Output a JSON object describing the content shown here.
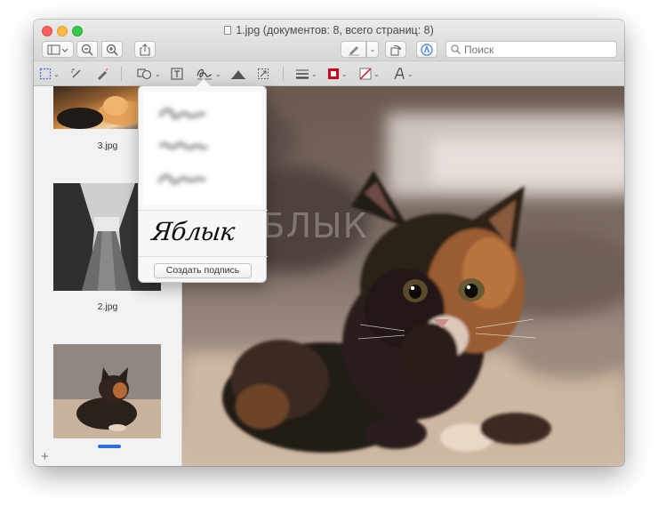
{
  "window": {
    "title": "1.jpg (документов: 8, всего страниц: 8)"
  },
  "toolbar": {
    "search_placeholder": "Поиск",
    "buttons": [
      "sidebar-toggle",
      "zoom-out",
      "zoom-in",
      "share",
      "highlight-pen",
      "rotate",
      "markup"
    ]
  },
  "markup_toolbar": {
    "tools": [
      "rectangular-selection",
      "instant-alpha",
      "sketch",
      "shapes",
      "text",
      "sign",
      "adjust-color",
      "adjust-size",
      "line-style",
      "border-color",
      "fill-color",
      "text-style"
    ]
  },
  "sidebar": {
    "thumbnails": [
      {
        "label": "3.jpg"
      },
      {
        "label": "2.jpg"
      },
      {
        "label": ""
      }
    ]
  },
  "signature_popover": {
    "signature_text": "Яблык",
    "create_button": "Создать подпись"
  },
  "main": {
    "watermark": "ЯБЛЫК"
  },
  "colors": {
    "accent": "#2d6ee0",
    "border_color_swatch": "#d0021b"
  }
}
